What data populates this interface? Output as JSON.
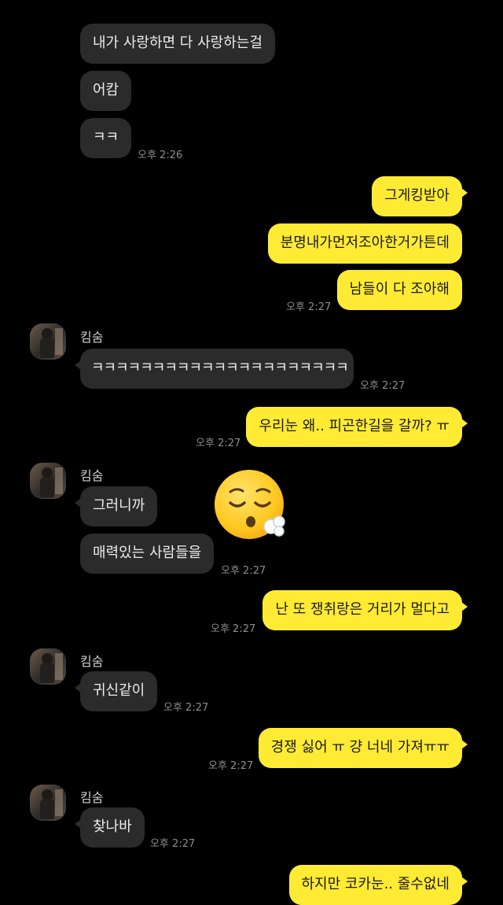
{
  "colors": {
    "background": "#000000",
    "incoming_bubble": "#2b2b2b",
    "outgoing_bubble": "#ffeb33"
  },
  "contact": {
    "name": "킴숨"
  },
  "messages": {
    "m1": "내가 사랑하면 다 사랑하는걸",
    "m2": "어캄",
    "m3": "ㅋㅋ",
    "m4": "그게킹받아",
    "m5": "분명내가먼저조아한거가튼데",
    "m6": "남들이 다 조아해",
    "m7": "ㅋㅋㅋㅋㅋㅋㅋㅋㅋㅋㅋㅋㅋㅋㅋㅋㅋㅋㅋㅋㅋ",
    "m8": "우리눈 왜.. 피곤한길을 갈까? ㅠ",
    "m9": "그러니까",
    "m10": "매력있는 사람들을",
    "m11": "난 또 쟁취랑은 거리가 멀다고",
    "m12": "귀신같이",
    "m13": "경쟁 싫어 ㅠ 걍 너네 가져ㅠㅠ",
    "m14": "찾나바",
    "m15": "하지만 코카눈.. 줄수없네"
  },
  "times": {
    "t226": "오후 2:26",
    "t227": "오후 2:27"
  },
  "emoji": {
    "name": "face-exhaling-emoji"
  }
}
